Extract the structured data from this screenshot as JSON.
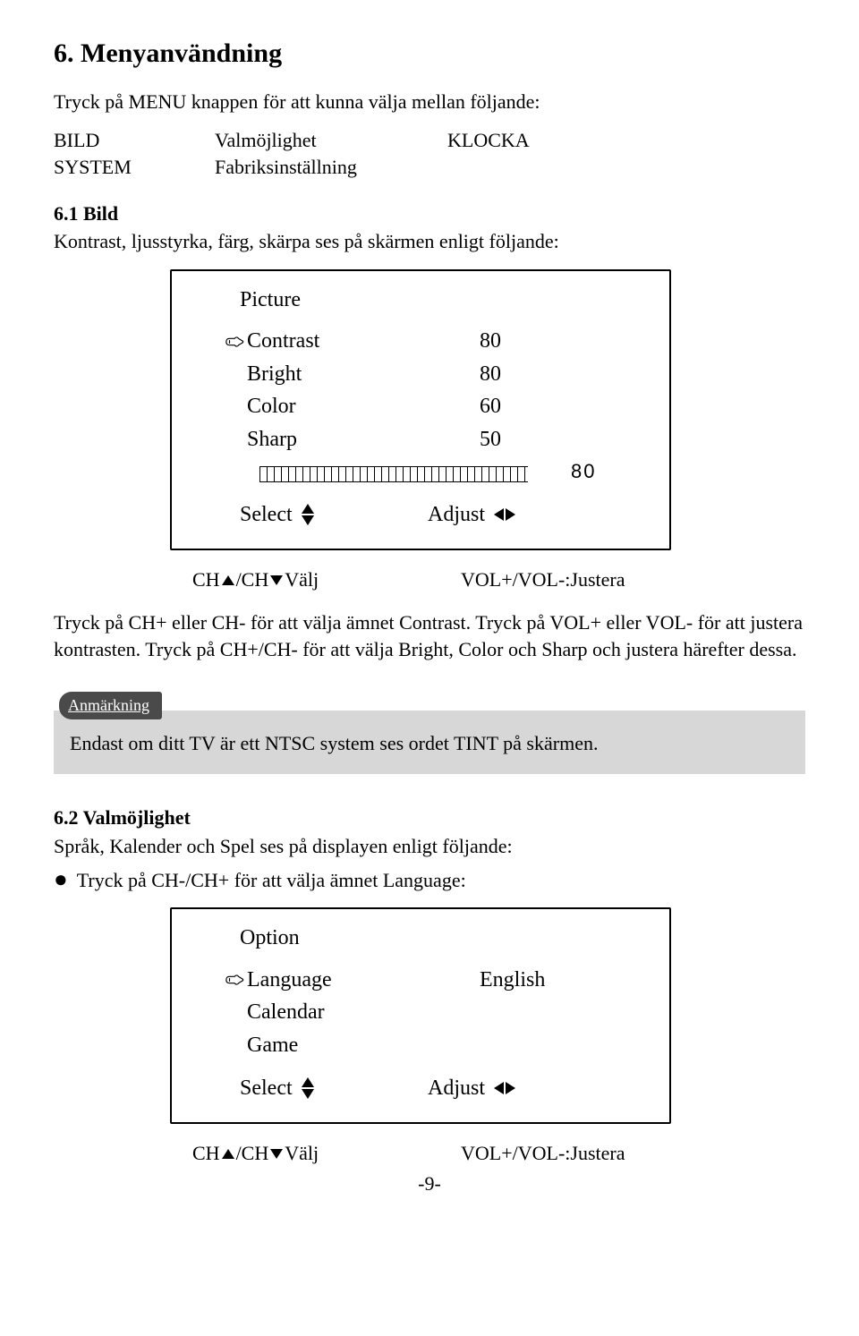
{
  "title": "6. Menyanvändning",
  "intro": "Tryck på MENU knappen för att kunna välja mellan följande:",
  "menu": {
    "r0c0": "BILD",
    "r0c1": "Valmöjlighet",
    "r0c2": "KLOCKA",
    "r1c0": "SYSTEM",
    "r1c1": "Fabriksinställning"
  },
  "s61": {
    "heading": "6.1 Bild",
    "desc": "Kontrast, ljusstyrka, färg, skärpa ses på skärmen enligt följande:"
  },
  "osd1": {
    "title": "Picture",
    "rows": [
      {
        "label": "Contrast",
        "val": "80",
        "hand": true
      },
      {
        "label": "Bright",
        "val": "80"
      },
      {
        "label": "Color",
        "val": "60"
      },
      {
        "label": "Sharp",
        "val": "50"
      }
    ],
    "bar_val": "80",
    "select": "Select",
    "adjust": "Adjust"
  },
  "chline": {
    "left_pre": "CH",
    "left_mid": "/CH",
    "left_suf": " Välj",
    "right": "VOL+/VOL-:Justera"
  },
  "para1": "Tryck på CH+ eller CH- för att välja ämnet Contrast. Tryck på VOL+ eller VOL- för  att justera kontrasten. Tryck på CH+/CH- för att välja Bright, Color och Sharp och justera härefter dessa.",
  "note": {
    "tab": "Anmärkning",
    "body": "Endast om ditt TV är ett NTSC system ses ordet TINT på skärmen."
  },
  "s62": {
    "heading": "6.2 Valmöjlighet",
    "desc": "Språk, Kalender och Spel ses på displayen enligt följande:",
    "bullet": "Tryck på CH-/CH+ för att välja ämnet Language:"
  },
  "osd2": {
    "title": "Option",
    "rows": [
      {
        "label": "Language",
        "val": "English",
        "hand": true
      },
      {
        "label": "Calendar",
        "val": ""
      },
      {
        "label": "Game",
        "val": ""
      }
    ],
    "select": "Select",
    "adjust": "Adjust"
  },
  "page_number": "-9-"
}
